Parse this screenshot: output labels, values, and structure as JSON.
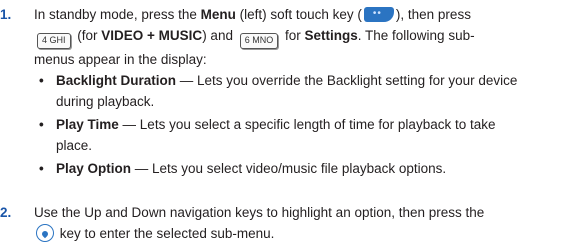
{
  "steps": [
    {
      "number": "1.",
      "p1": "In standby mode, press the ",
      "menu": "Menu",
      "p2": " (left) soft touch key (",
      "p3": "), then press",
      "key4": "4 GHI",
      "p4": " (for ",
      "video_music": "VIDEO + MUSIC",
      "p5": ") and ",
      "key6": "6 MNO",
      "p6": " for ",
      "settings": "Settings",
      "p7": ". The following sub-",
      "line3": "menus appear in the display:"
    },
    {
      "number": "2.",
      "line1": "Use the Up and Down navigation keys to highlight an option, then press the",
      "line2": " key to enter the selected sub-menu."
    }
  ],
  "submenus": [
    {
      "title": "Backlight Duration",
      "desc_line1": " — Lets you override the Backlight setting for your device",
      "desc_line2": "during playback."
    },
    {
      "title": "Play Time",
      "desc_line1": " — Lets you select a specific length of time for playback to take",
      "desc_line2": "place."
    },
    {
      "title": "Play Option",
      "desc_line1": " — Lets you select video/music file playback options.",
      "desc_line2": ""
    }
  ],
  "icons": {
    "menu_soft_key": "left-soft-touch-key-icon",
    "key_4": "key-4-ghi-icon",
    "key_6": "key-6-mno-icon",
    "ok_key": "ok-select-key-icon"
  },
  "colors": {
    "step_number": "#1a55a8",
    "soft_key": "#2b74c2"
  }
}
